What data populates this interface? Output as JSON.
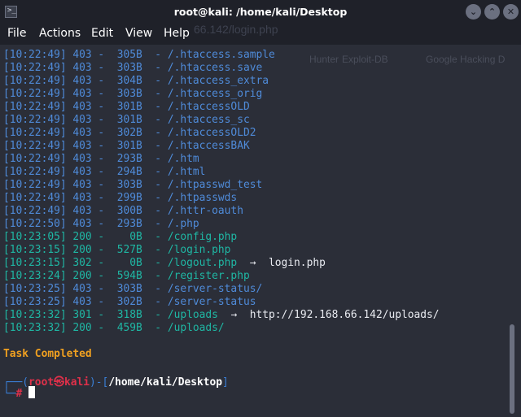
{
  "window": {
    "title": "root@kali: /home/kali/Desktop",
    "minimize_glyph": "⌄",
    "maximize_glyph": "⌃",
    "close_glyph": "✕"
  },
  "menu": [
    "File",
    "Actions",
    "Edit",
    "View",
    "Help"
  ],
  "background_ghost": {
    "url": "66.142/login.php",
    "bookmarks": [
      "Hunter",
      "Exploit-DB",
      "Google Hacking D"
    ]
  },
  "output_lines": [
    {
      "time": "[10:22:49]",
      "status": "403",
      "size": "305B",
      "path": "/.htaccess.sample",
      "redirect": "",
      "color": "blue"
    },
    {
      "time": "[10:22:49]",
      "status": "403",
      "size": "303B",
      "path": "/.htaccess.save",
      "redirect": "",
      "color": "blue"
    },
    {
      "time": "[10:22:49]",
      "status": "403",
      "size": "304B",
      "path": "/.htaccess_extra",
      "redirect": "",
      "color": "blue"
    },
    {
      "time": "[10:22:49]",
      "status": "403",
      "size": "303B",
      "path": "/.htaccess_orig",
      "redirect": "",
      "color": "blue"
    },
    {
      "time": "[10:22:49]",
      "status": "403",
      "size": "301B",
      "path": "/.htaccessOLD",
      "redirect": "",
      "color": "blue"
    },
    {
      "time": "[10:22:49]",
      "status": "403",
      "size": "301B",
      "path": "/.htaccess_sc",
      "redirect": "",
      "color": "blue"
    },
    {
      "time": "[10:22:49]",
      "status": "403",
      "size": "302B",
      "path": "/.htaccessOLD2",
      "redirect": "",
      "color": "blue"
    },
    {
      "time": "[10:22:49]",
      "status": "403",
      "size": "301B",
      "path": "/.htaccessBAK",
      "redirect": "",
      "color": "blue"
    },
    {
      "time": "[10:22:49]",
      "status": "403",
      "size": "293B",
      "path": "/.htm",
      "redirect": "",
      "color": "blue"
    },
    {
      "time": "[10:22:49]",
      "status": "403",
      "size": "294B",
      "path": "/.html",
      "redirect": "",
      "color": "blue"
    },
    {
      "time": "[10:22:49]",
      "status": "403",
      "size": "303B",
      "path": "/.htpasswd_test",
      "redirect": "",
      "color": "blue"
    },
    {
      "time": "[10:22:49]",
      "status": "403",
      "size": "299B",
      "path": "/.htpasswds",
      "redirect": "",
      "color": "blue"
    },
    {
      "time": "[10:22:49]",
      "status": "403",
      "size": "300B",
      "path": "/.httr-oauth",
      "redirect": "",
      "color": "blue"
    },
    {
      "time": "[10:22:50]",
      "status": "403",
      "size": "293B",
      "path": "/.php",
      "redirect": "",
      "color": "blue"
    },
    {
      "time": "[10:23:05]",
      "status": "200",
      "size": "0B",
      "path": "/config.php",
      "redirect": "",
      "color": "green"
    },
    {
      "time": "[10:23:15]",
      "status": "200",
      "size": "527B",
      "path": "/login.php",
      "redirect": "",
      "color": "green"
    },
    {
      "time": "[10:23:15]",
      "status": "302",
      "size": "0B",
      "path": "/logout.php",
      "redirect": "login.php",
      "color": "green"
    },
    {
      "time": "[10:23:24]",
      "status": "200",
      "size": "594B",
      "path": "/register.php",
      "redirect": "",
      "color": "green"
    },
    {
      "time": "[10:23:25]",
      "status": "403",
      "size": "303B",
      "path": "/server-status/",
      "redirect": "",
      "color": "blue"
    },
    {
      "time": "[10:23:25]",
      "status": "403",
      "size": "302B",
      "path": "/server-status",
      "redirect": "",
      "color": "blue"
    },
    {
      "time": "[10:23:32]",
      "status": "301",
      "size": "318B",
      "path": "/uploads",
      "redirect": "http://192.168.66.142/uploads/",
      "color": "green"
    },
    {
      "time": "[10:23:32]",
      "status": "200",
      "size": "459B",
      "path": "/uploads/",
      "redirect": "",
      "color": "green"
    }
  ],
  "arrow": "→",
  "task_completed": "Task Completed",
  "prompt": {
    "user": "root",
    "host": "kali",
    "skull": "㉿",
    "cwd": "/home/kali/Desktop",
    "symbol": "#"
  },
  "colors": {
    "background": "#2b2e38",
    "titlebar": "#1f2129",
    "blue_line": "#4f8bd9",
    "green_line": "#1fb7a4",
    "task": "#f0a020",
    "prompt_red": "#e0304a",
    "prompt_blue": "#3a7fd6"
  }
}
